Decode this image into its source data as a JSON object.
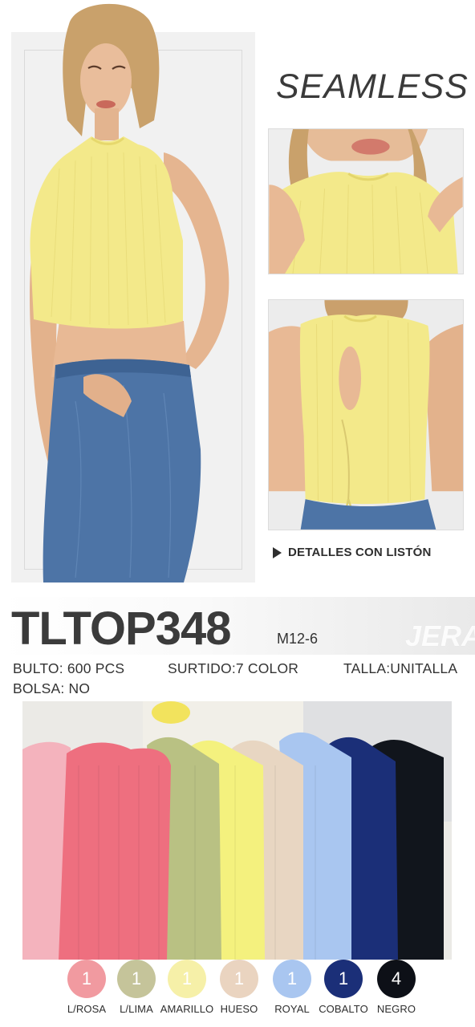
{
  "headline": "SEAMLESS",
  "detail_caption": "DETALLES CON LISTÓN",
  "product_code": "TLTOP348",
  "model_code": "M12-6",
  "watermark": "JERA",
  "specs": {
    "bulto": "BULTO: 600 PCS",
    "surtido": "SURTIDO:7 COLOR",
    "talla": "TALLA:UNITALLA",
    "bolsa": "BOLSA: NO"
  },
  "colors": [
    {
      "label": "L/ROSA",
      "qty": "1",
      "hex": "#f19aa0"
    },
    {
      "label": "L/LIMA",
      "qty": "1",
      "hex": "#c5c49a"
    },
    {
      "label": "AMARILLO",
      "qty": "1",
      "hex": "#f6f0a8"
    },
    {
      "label": "HUESO",
      "qty": "1",
      "hex": "#ead4c0"
    },
    {
      "label": "ROYAL",
      "qty": "1",
      "hex": "#a9c6f0"
    },
    {
      "label": "COBALTO",
      "qty": "1",
      "hex": "#1b2f78"
    },
    {
      "label": "NEGRO",
      "qty": "4",
      "hex": "#0d1017"
    }
  ],
  "top_color": "#f3e98a"
}
